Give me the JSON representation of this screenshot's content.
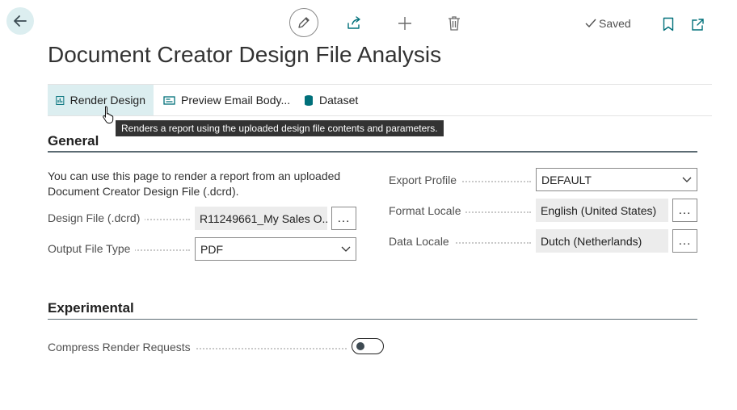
{
  "page": {
    "title": "Document Creator Design File Analysis"
  },
  "header": {
    "saved_label": "Saved"
  },
  "actions": {
    "render_design": "Render Design",
    "preview_email_body": "Preview Email Body...",
    "dataset": "Dataset"
  },
  "tooltip": "Renders a report using the uploaded design file contents and parameters.",
  "general": {
    "title": "General",
    "intro": "You can use this page to render a report from an uploaded Document Creator Design File (.dcrd).",
    "design_file": {
      "label": "Design File (.dcrd)",
      "value": "R11249661_My Sales O..."
    },
    "output_file_type": {
      "label": "Output File Type",
      "value": "PDF"
    },
    "export_profile": {
      "label": "Export Profile",
      "value": "DEFAULT"
    },
    "format_locale": {
      "label": "Format Locale",
      "value": "English (United States)"
    },
    "data_locale": {
      "label": "Data Locale",
      "value": "Dutch (Netherlands)"
    },
    "more_label": "..."
  },
  "experimental": {
    "title": "Experimental",
    "compress_render_requests": {
      "label": "Compress Render Requests",
      "on": false
    }
  },
  "colors": {
    "accent": "#00707a",
    "selected_bg": "#dceef0",
    "tooltip_bg": "#333333"
  },
  "icons": [
    "arrow-left-icon",
    "pencil-icon",
    "share-icon",
    "plus-icon",
    "trash-icon",
    "checkmark-icon",
    "bookmark-icon",
    "open-in-new-icon",
    "report-icon",
    "email-preview-icon",
    "database-icon",
    "chevron-down-icon",
    "mouse-pointer-icon"
  ]
}
